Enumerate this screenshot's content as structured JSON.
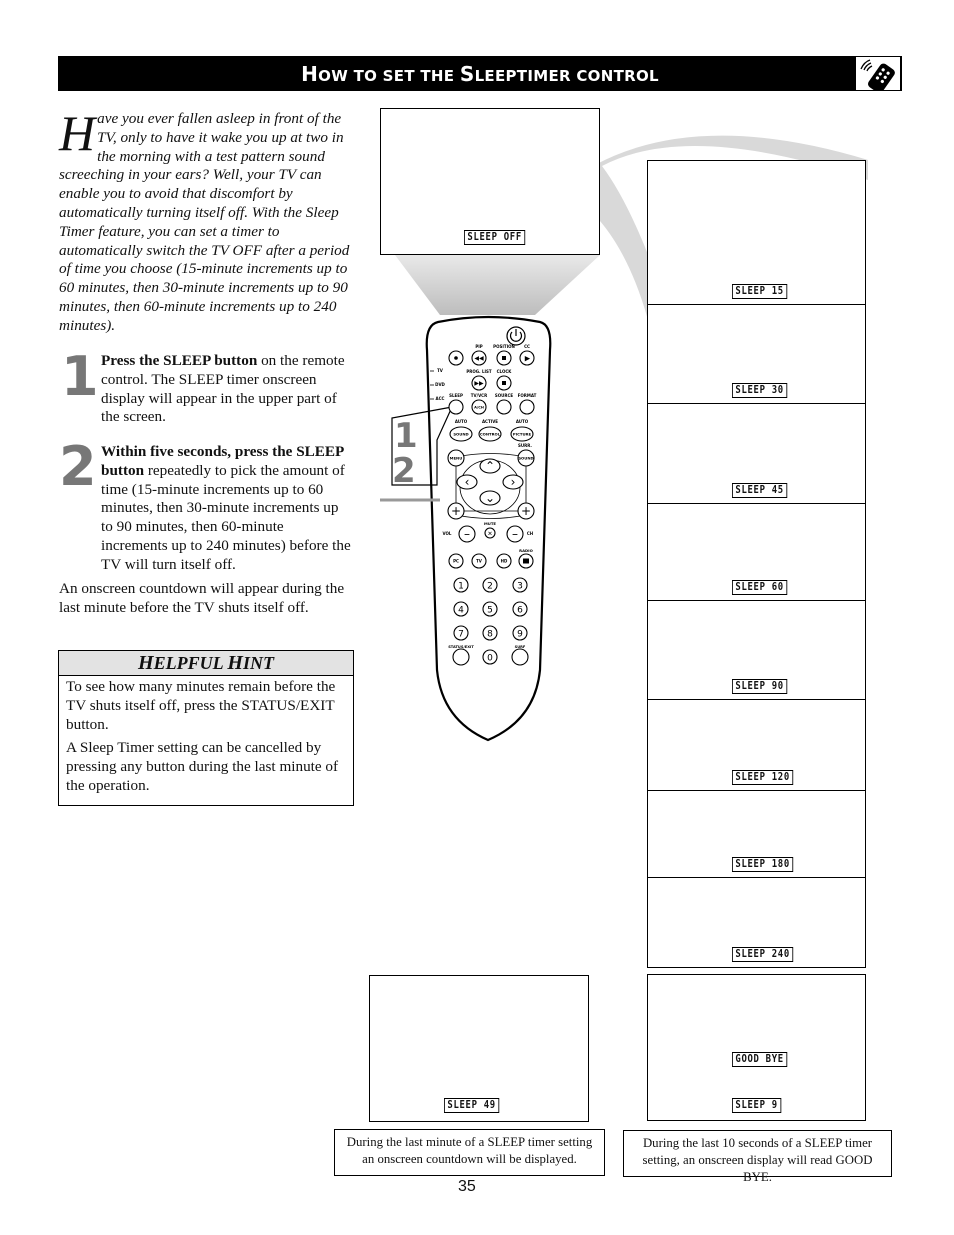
{
  "header": {
    "title_parts": [
      {
        "text": "H",
        "big": true
      },
      {
        "text": "OW TO SET THE ",
        "big": false
      },
      {
        "text": "S",
        "big": true
      },
      {
        "text": "LEEPTIMER CONTROL",
        "big": false
      }
    ],
    "icon": "remote-control-icon"
  },
  "intro": {
    "drop_cap": "H",
    "text": "ave you ever fallen asleep in front of the TV, only to have it wake you up at two in the morning with a test pattern sound screeching in your ears?  Well, your TV can enable you to avoid that discomfort by automatically turning itself off. With the Sleep Timer feature, you can set a timer to automatically switch the TV OFF after a period of time you choose (15-minute increments up to 60 minutes, then 30-minute increments up to 90 minutes, then 60-minute increments up to 240 minutes)."
  },
  "steps": [
    {
      "number": "1",
      "bold": "Press the SLEEP button",
      "text": " on the remote control.  The SLEEP timer onscreen display will appear in the upper part of the screen."
    },
    {
      "number": "2",
      "bold": "Within five seconds, press the SLEEP button",
      "text": " repeatedly to pick the amount of time (15-minute increments up to 60 minutes, then 30-minute increments up to 90 minutes, then 60-minute increments up to 240 minutes) before the TV will turn itself off."
    }
  ],
  "after_steps": "An onscreen countdown will appear during the last minute before the TV shuts itself off.",
  "hint": {
    "title_parts": [
      {
        "text": "H",
        "big": true
      },
      {
        "text": "ELPFUL ",
        "big": false
      },
      {
        "text": "H",
        "big": true
      },
      {
        "text": "INT",
        "big": false
      }
    ],
    "paragraphs": [
      "To see how many minutes remain before the TV shuts itself off, press the STATUS/EXIT button.",
      "A Sleep Timer setting can be cancelled by pressing any button during the last minute of the operation."
    ]
  },
  "screens": {
    "initial": "SLEEP OFF",
    "sequence": [
      "SLEEP 15",
      "SLEEP 30",
      "SLEEP 45",
      "SLEEP 60",
      "SLEEP 90",
      "SLEEP 120",
      "SLEEP 180",
      "SLEEP 240"
    ],
    "countdown": "SLEEP 49",
    "goodbye": {
      "top": "GOOD BYE",
      "bottom": "SLEEP 9"
    }
  },
  "captions": {
    "countdown": "During the last minute of a SLEEP timer setting an onscreen countdown will be displayed.",
    "goodbye": "During the last 10 seconds of a SLEEP timer setting, an onscreen display will read GOOD BYE."
  },
  "remote": {
    "callout_numbers": [
      "1",
      "2"
    ],
    "mode_labels": [
      "TV",
      "DVD",
      "ACC"
    ],
    "row1_labels": [
      "PIP",
      "POSITION",
      "CC"
    ],
    "row2_labels": [
      "PROG. LIST",
      "CLOCK"
    ],
    "row3_labels": [
      "SLEEP",
      "TV/VCR",
      "SOURCE",
      "FORMAT"
    ],
    "row3_inner": [
      "",
      "A/CH",
      "",
      ""
    ],
    "row4_top": [
      "AUTO",
      "ACTIVE",
      "AUTO"
    ],
    "row4_inner": [
      "SOUND",
      "CONTROL",
      "PICTURE"
    ],
    "surr": "SURR.",
    "menu": "MENU",
    "sound": "SOUND",
    "mute": "MUTE",
    "vol": "VOL",
    "ch": "CH",
    "radio": "RADIO",
    "src_buttons": [
      "PC",
      "TV",
      "HD"
    ],
    "digits": [
      "1",
      "2",
      "3",
      "4",
      "5",
      "6",
      "7",
      "8",
      "9",
      "0"
    ],
    "status_exit": "STATUS/EXIT",
    "surf": "SURF"
  },
  "page_number": "35"
}
